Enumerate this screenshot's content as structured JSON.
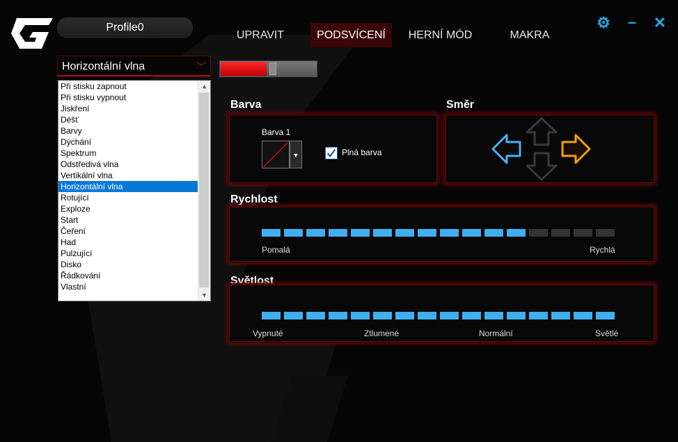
{
  "app": {
    "profile_name": "Profile0"
  },
  "tabs": [
    {
      "label": "UPRAVIT",
      "active": false
    },
    {
      "label": "PODSVÍCENÍ",
      "active": true
    },
    {
      "label": "HERNÍ MÓD",
      "active": false
    },
    {
      "label": "MAKRA",
      "active": false
    }
  ],
  "window_controls": {
    "settings_icon": "gear-icon",
    "minimize_icon": "minus-icon",
    "close_icon": "x-icon",
    "color": "#2aa5ea"
  },
  "effect": {
    "selected": "Horizontální vlna",
    "options": [
      "Při stisku zapnout",
      "Při stisku vypnout",
      "Jiskření",
      "Déšť",
      "Barvy",
      "Dýchání",
      "Spektrum",
      "Odstředivá vlna",
      "Vertikální vlna",
      "Horizontální vlna",
      "Rotující",
      "Exploze",
      "Start",
      "Čeření",
      "Had",
      "Pulzující",
      "Disko",
      "Řádkování",
      "Vlastní"
    ]
  },
  "top_slider": {
    "level": 0.48,
    "fill_color": "#e00000"
  },
  "barva": {
    "heading": "Barva",
    "color1_label": "Barva 1",
    "solid_label": "Plná barva",
    "solid_checked": true
  },
  "smer": {
    "heading": "Směr",
    "active_direction": "right",
    "icons": [
      "left-arrow-icon",
      "up-arrow-icon",
      "down-arrow-icon",
      "right-arrow-icon"
    ]
  },
  "rychlost": {
    "heading": "Rychlost",
    "segments_total": 16,
    "segments_active": 12,
    "min_label": "Pomalá",
    "max_label": "Rychlá"
  },
  "svetlost": {
    "heading": "Světlost",
    "segments_total": 16,
    "segments_active": 16,
    "labels": [
      "Vypnuté",
      "Ztlumené",
      "Normální",
      "Světlé"
    ]
  },
  "colors": {
    "accent_red": "#c00000",
    "active_blue": "#3fb0ef",
    "inactive_segment": "#333333",
    "arrow_left": "#4ab0f0",
    "arrow_right": "#f5a000"
  }
}
